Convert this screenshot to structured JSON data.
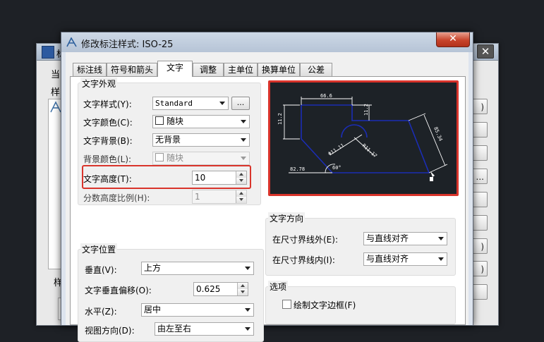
{
  "background_dialog": {
    "title": "标",
    "close_glyph": "✕",
    "left_labels": [
      "当",
      "样",
      "样"
    ],
    "side_buttons": [
      ")",
      "",
      "",
      "...",
      "",
      "",
      ")",
      ")",
      ""
    ]
  },
  "dialog": {
    "title": "修改标注样式: ISO-25",
    "close_glyph": "✕",
    "tabs": [
      "标注线",
      "符号和箭头",
      "文字",
      "调整",
      "主单位",
      "换算单位",
      "公差"
    ],
    "active_tab": "文字"
  },
  "appearance": {
    "group_title": "文字外观",
    "text_style_label": "文字样式(Y):",
    "text_style_value": "Standard",
    "browse_label": "...",
    "text_color_label": "文字颜色(C):",
    "text_color_value": "随块",
    "text_bg_label": "文字背景(B):",
    "text_bg_value": "无背景",
    "bg_color_label": "背景颜色(L):",
    "bg_color_value": "随块",
    "text_height_label": "文字高度(T):",
    "text_height_value": "10",
    "fraction_scale_label": "分数高度比例(H):",
    "fraction_scale_value": "1"
  },
  "placement": {
    "group_title": "文字位置",
    "vertical_label": "垂直(V):",
    "vertical_value": "上方",
    "offset_label": "文字垂直偏移(O):",
    "offset_value": "0.625",
    "horizontal_label": "水平(Z):",
    "horizontal_value": "居中",
    "view_dir_label": "视图方向(D):",
    "view_dir_value": "由左至右"
  },
  "alignment": {
    "group_title": "文字方向",
    "outside_label": "在尺寸界线外(E):",
    "outside_value": "与直线对齐",
    "inside_label": "在尺寸界线内(I):",
    "inside_value": "与直线对齐"
  },
  "options": {
    "group_title": "选项",
    "draw_frame_label": "绘制文字边框(F)",
    "draw_frame_checked": false
  },
  "preview": {
    "dim_top": "66.6",
    "dim_left": "11.2",
    "dim_mid": "11.2",
    "dim_right": "85.34",
    "dim_bottom": "82.78",
    "dim_radius": "R11.17",
    "dim_diameter": "Φ11.11",
    "dim_angle": "60°",
    "colors": {
      "bg": "#1d2227",
      "shape": "#1b2db4",
      "dim": "#ffffff",
      "frame": "#d9342b"
    }
  },
  "highlight_color": "#d9342b"
}
